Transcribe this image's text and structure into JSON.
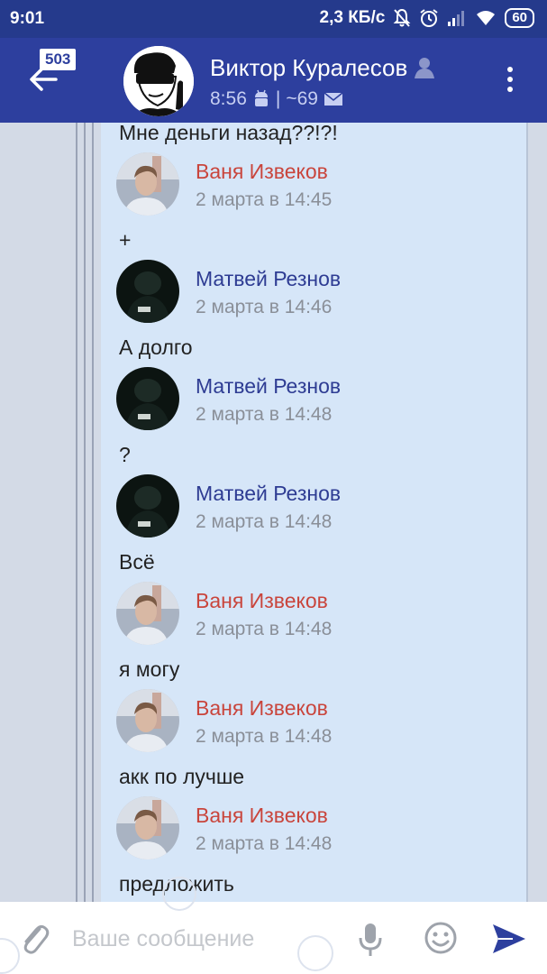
{
  "status_bar": {
    "time": "9:01",
    "network_speed": "2,3 КБ/с",
    "battery": "60",
    "icons": [
      "mute-icon",
      "alarm-icon",
      "signal-icon",
      "wifi-icon",
      "battery-icon"
    ]
  },
  "header": {
    "unread_count": "503",
    "name": "Виктор Куралесов",
    "last_seen": "8:56",
    "separator": "|",
    "messages_count": "~69",
    "colors": {
      "bar": "#2d3f9e",
      "status": "#253a8c"
    }
  },
  "chat": {
    "partial_top_text": "Мне деньги назад??!?!",
    "messages": [
      {
        "author": "Ваня Извеков",
        "author_color": "red",
        "time": "2 марта в 14:45",
        "text": "+"
      },
      {
        "author": "Матвей Резнов",
        "author_color": "blue",
        "time": "2 марта в 14:46",
        "text": "А долго"
      },
      {
        "author": "Матвей Резнов",
        "author_color": "blue",
        "time": "2 марта в 14:48",
        "text": "?"
      },
      {
        "author": "Матвей Резнов",
        "author_color": "blue",
        "time": "2 марта в 14:48",
        "text": "Всё"
      },
      {
        "author": "Ваня Извеков",
        "author_color": "red",
        "time": "2 марта в 14:48",
        "text": "я могу"
      },
      {
        "author": "Ваня Извеков",
        "author_color": "red",
        "time": "2 марта в 14:48",
        "text": "акк по лучше"
      },
      {
        "author": "Ваня Извеков",
        "author_color": "red",
        "time": "2 марта в 14:48",
        "text": "предложить"
      }
    ]
  },
  "composer": {
    "placeholder": "Ваше сообщение",
    "value": ""
  }
}
